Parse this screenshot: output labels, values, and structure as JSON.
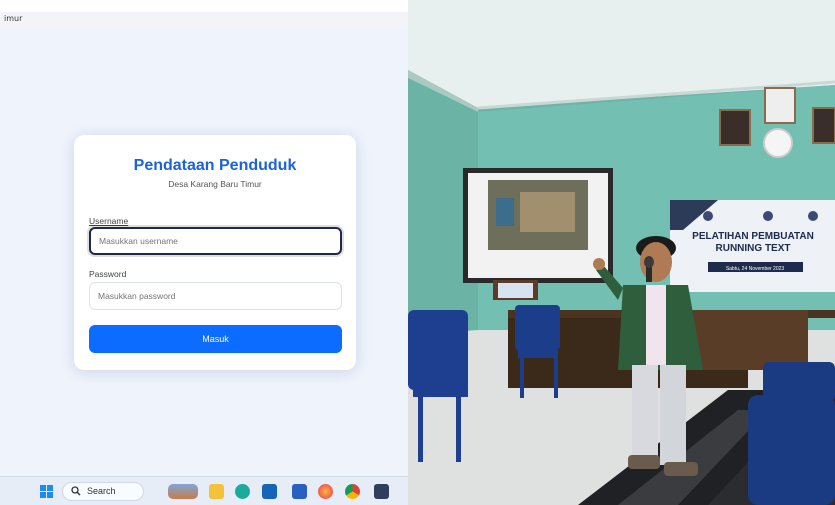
{
  "browser": {
    "tab_text": "imur"
  },
  "login": {
    "title": "Pendataan Penduduk",
    "subtitle": "Desa Karang Baru Timur",
    "username_label": "Username",
    "username_placeholder": "Masukkan username",
    "password_label": "Password",
    "password_placeholder": "Masukkan password",
    "submit_label": "Masuk"
  },
  "taskbar": {
    "search_label": "Search",
    "icons": [
      "windows-start-icon",
      "search-icon",
      "weather-icon",
      "file-explorer-icon",
      "edge-icon",
      "store-icon",
      "ms-app-icon",
      "firefox-icon",
      "chrome-icon",
      "app-icon"
    ]
  },
  "photo": {
    "banner_title_line1": "PELATIHAN PEMBUATAN",
    "banner_title_line2": "RUNNING TEXT",
    "banner_date": "Sabtu, 24 November 2023"
  }
}
